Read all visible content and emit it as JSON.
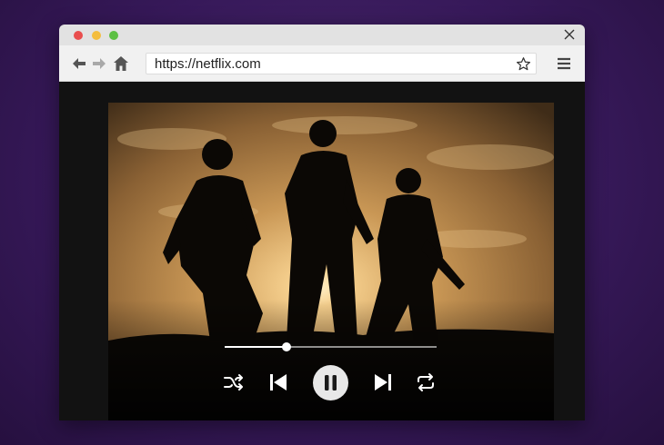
{
  "browser": {
    "url": "https://netflix.com",
    "window_controls": {
      "close_color": "#e94e4e",
      "minimize_color": "#f4bd3e",
      "maximize_color": "#5dc044"
    },
    "icons": {
      "back": "arrow-left-icon",
      "forward": "arrow-right-icon",
      "home": "home-icon",
      "bookmark": "star-icon",
      "menu": "hamburger-menu-icon",
      "close": "close-icon"
    }
  },
  "player": {
    "progress": 0.29,
    "accent_color": "#ffffff",
    "controls": [
      "shuffle",
      "previous",
      "pause",
      "next",
      "repeat"
    ]
  }
}
